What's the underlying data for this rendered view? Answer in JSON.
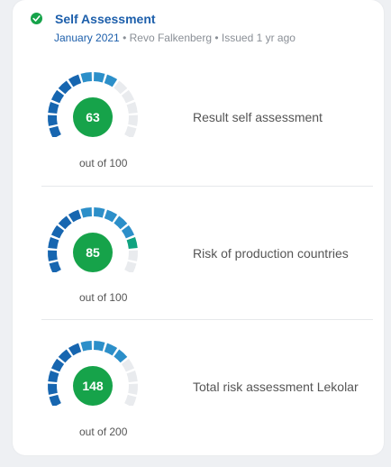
{
  "header": {
    "title": "Self Assessment",
    "date": "January 2021",
    "separator": "•",
    "author": "Revo Falkenberg",
    "issued": "Issued 1 yr ago",
    "status_icon": "check-circle-icon"
  },
  "colors": {
    "primary_blue": "#1d5fab",
    "gauge_blue": "#2c8fc9",
    "gauge_dark_blue": "#1766b0",
    "gauge_green": "#10a37f",
    "gauge_inactive": "#e9ebee",
    "score_green": "#16a34a",
    "status_green": "#16a34a"
  },
  "assessments": [
    {
      "score": "63",
      "max": 100,
      "label": "Result self assessment",
      "out_of": "out of 100"
    },
    {
      "score": "85",
      "max": 100,
      "label": "Risk of production countries",
      "out_of": "out of 100"
    },
    {
      "score": "148",
      "max": 200,
      "label": "Total risk assessment Lekolar",
      "out_of": "out of 200"
    }
  ]
}
